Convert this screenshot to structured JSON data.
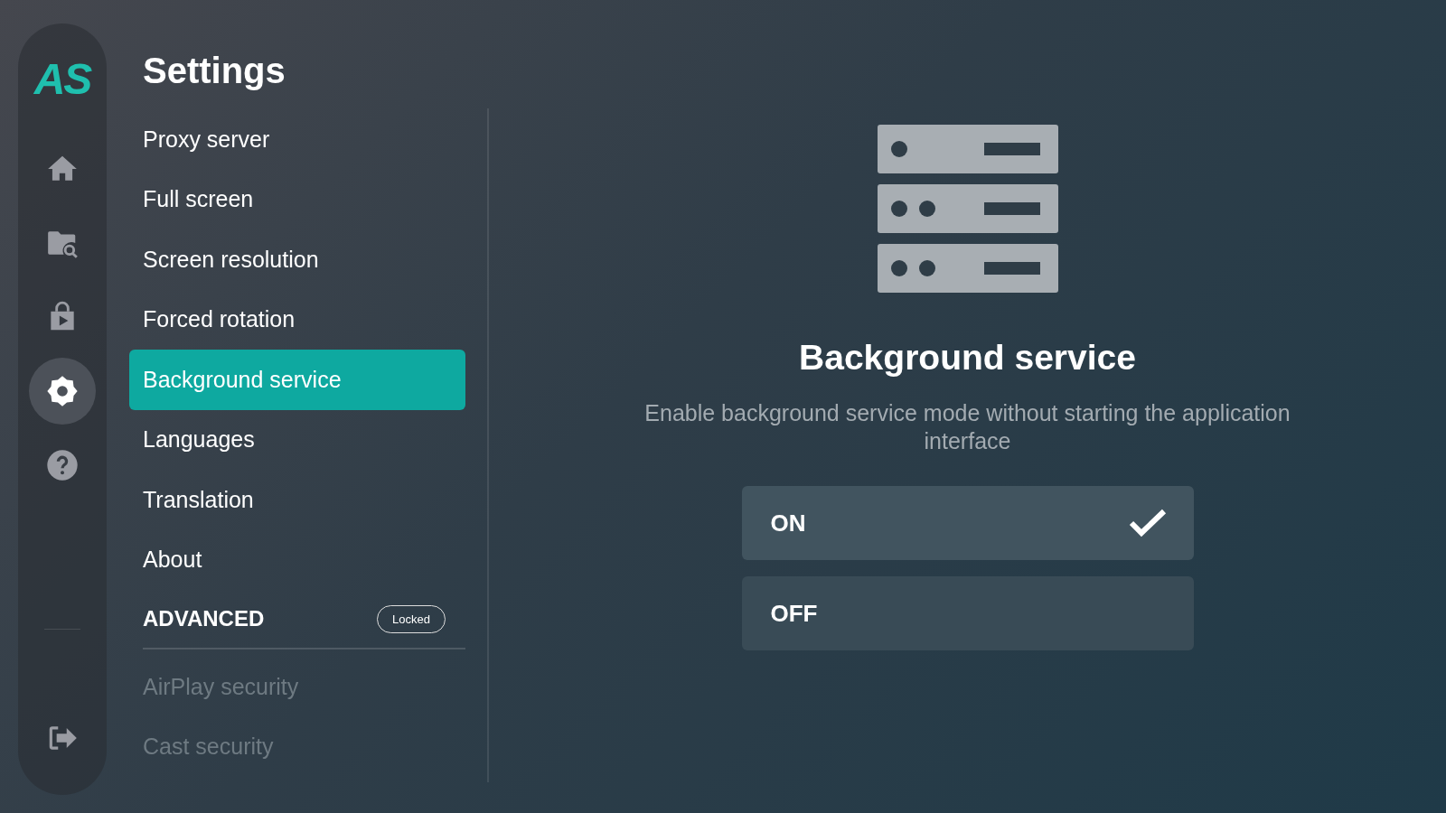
{
  "logo": {
    "text": "AS"
  },
  "nav": [
    {
      "kind": "home",
      "selected": false
    },
    {
      "kind": "folder-search",
      "selected": false
    },
    {
      "kind": "store",
      "selected": false
    },
    {
      "kind": "settings",
      "selected": true
    },
    {
      "kind": "help",
      "selected": false
    }
  ],
  "nav_bottom": [
    {
      "kind": "logout",
      "selected": false
    }
  ],
  "title": "Settings",
  "menu": [
    {
      "label": "Proxy server",
      "selected": false,
      "disabled": false
    },
    {
      "label": "Full screen",
      "selected": false,
      "disabled": false
    },
    {
      "label": "Screen resolution",
      "selected": false,
      "disabled": false
    },
    {
      "label": "Forced rotation",
      "selected": false,
      "disabled": false
    },
    {
      "label": "Background service",
      "selected": true,
      "disabled": false
    },
    {
      "label": "Languages",
      "selected": false,
      "disabled": false
    },
    {
      "label": "Translation",
      "selected": false,
      "disabled": false
    },
    {
      "label": "About",
      "selected": false,
      "disabled": false
    }
  ],
  "advanced": {
    "label": "ADVANCED",
    "badge": "Locked"
  },
  "advanced_menu": [
    {
      "label": "AirPlay security",
      "selected": false,
      "disabled": true
    },
    {
      "label": "Cast security",
      "selected": false,
      "disabled": true
    }
  ],
  "detail": {
    "heading": "Background service",
    "description": "Enable background service mode without starting the application interface",
    "options": [
      {
        "label": "ON",
        "selected": true
      },
      {
        "label": "OFF",
        "selected": false
      }
    ]
  }
}
